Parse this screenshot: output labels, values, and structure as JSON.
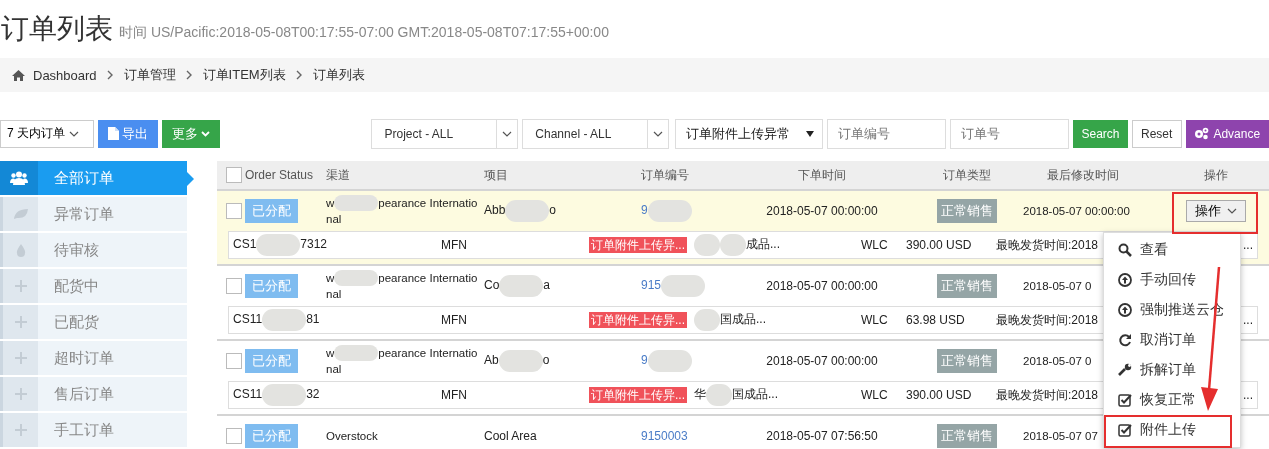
{
  "page": {
    "title": "订单列表",
    "subtitle": "时间 US/Pacific:2018-05-08T00:17:55-07:00 GMT:2018-05-08T07:17:55+00:00"
  },
  "breadcrumb": [
    {
      "label": "Dashboard",
      "kind": "home"
    },
    {
      "label": "订单管理",
      "kind": "link"
    },
    {
      "label": "订单ITEM列表",
      "kind": "link"
    },
    {
      "label": "订单列表",
      "kind": "current"
    }
  ],
  "toolbar": {
    "range": "7 天内订单",
    "export": "导出",
    "more": "更多"
  },
  "filters": {
    "project": "Project - ALL",
    "channel": "Channel - ALL",
    "status": "订单附件上传异常",
    "order_no_placeholder": "订单编号",
    "order_id_placeholder": "订单号",
    "search": "Search",
    "reset": "Reset",
    "advance": "Advance"
  },
  "sidebar": {
    "items": [
      {
        "label": "全部订单",
        "kind": "group",
        "selected": true
      },
      {
        "label": "异常订单",
        "kind": "leaf",
        "selected": false
      },
      {
        "label": "待审核",
        "kind": "drop",
        "selected": false
      },
      {
        "label": "配货中",
        "kind": "plus",
        "selected": false
      },
      {
        "label": "已配货",
        "kind": "plus",
        "selected": false
      },
      {
        "label": "超时订单",
        "kind": "plus",
        "selected": false
      },
      {
        "label": "售后订单",
        "kind": "plus",
        "selected": false
      },
      {
        "label": "手工订单",
        "kind": "plus",
        "selected": false
      }
    ]
  },
  "table": {
    "columns": [
      "Order Status",
      "渠道",
      "项目",
      "订单编号",
      "下单时间",
      "订单类型",
      "最后修改时间",
      "操作"
    ],
    "header_checked": false,
    "rows": [
      {
        "checked": false,
        "highlighted": true,
        "status": "已分配",
        "channel": [
          {
            "kind": "text",
            "text": "w"
          },
          {
            "kind": "blur"
          },
          {
            "kind": "text",
            "text": "pearance Internatio"
          },
          {
            "kind": "break"
          },
          {
            "kind": "text",
            "text": "nal"
          }
        ],
        "project": [
          {
            "kind": "text",
            "text": "Abb"
          },
          {
            "kind": "blur"
          },
          {
            "kind": "text",
            "text": "o"
          }
        ],
        "order_no": [
          {
            "kind": "text",
            "text": "9"
          },
          {
            "kind": "blur"
          }
        ],
        "order_time": "2018-05-07 00:00:00",
        "type": "正常销售",
        "modified": "2018-05-07 00:00:00",
        "action": "操作",
        "detail": {
          "code": [
            {
              "kind": "text",
              "text": "CS1"
            },
            {
              "kind": "blur"
            },
            {
              "kind": "text",
              "text": "7312"
            }
          ],
          "fulfil": "MFN",
          "tag": "订单附件上传异...",
          "product": [
            {
              "kind": "blur"
            },
            {
              "kind": "blur"
            },
            {
              "kind": "text",
              "text": "成品..."
            }
          ],
          "warehouse": "WLC",
          "amount": "390.00 USD",
          "deadline": "最晚发货时间:2018",
          "tail": "..."
        }
      },
      {
        "checked": false,
        "highlighted": false,
        "status": "已分配",
        "channel": [
          {
            "kind": "text",
            "text": "w"
          },
          {
            "kind": "blur"
          },
          {
            "kind": "text",
            "text": "pearance Internatio"
          },
          {
            "kind": "break"
          },
          {
            "kind": "text",
            "text": "nal"
          }
        ],
        "project": [
          {
            "kind": "text",
            "text": "Co"
          },
          {
            "kind": "blur"
          },
          {
            "kind": "text",
            "text": "a"
          }
        ],
        "order_no": [
          {
            "kind": "text",
            "text": "915"
          },
          {
            "kind": "blur"
          }
        ],
        "order_time": "2018-05-07 00:00:00",
        "type": "正常销售",
        "modified": "2018-05-07 0",
        "detail": {
          "code": [
            {
              "kind": "text",
              "text": "CS11"
            },
            {
              "kind": "blur"
            },
            {
              "kind": "text",
              "text": "81"
            }
          ],
          "fulfil": "MFN",
          "tag": "订单附件上传异...",
          "product": [
            {
              "kind": "blur"
            },
            {
              "kind": "text",
              "text": "国成品..."
            }
          ],
          "warehouse": "WLC",
          "amount": "63.98 USD",
          "deadline": "最晚发货时间:2018",
          "tail": "..."
        }
      },
      {
        "checked": false,
        "highlighted": false,
        "status": "已分配",
        "channel": [
          {
            "kind": "text",
            "text": "w"
          },
          {
            "kind": "blur"
          },
          {
            "kind": "text",
            "text": "pearance Internatio"
          },
          {
            "kind": "break"
          },
          {
            "kind": "text",
            "text": "nal"
          }
        ],
        "project": [
          {
            "kind": "text",
            "text": "Ab"
          },
          {
            "kind": "blur"
          },
          {
            "kind": "text",
            "text": "o"
          }
        ],
        "order_no": [
          {
            "kind": "text",
            "text": "9"
          },
          {
            "kind": "blur"
          }
        ],
        "order_time": "2018-05-07 00:00:00",
        "type": "正常销售",
        "modified": "2018-05-07 0",
        "detail": {
          "code": [
            {
              "kind": "text",
              "text": "CS11"
            },
            {
              "kind": "blur"
            },
            {
              "kind": "text",
              "text": "32"
            }
          ],
          "fulfil": "MFN",
          "tag": "订单附件上传异...",
          "product": [
            {
              "kind": "text",
              "text": "华"
            },
            {
              "kind": "blur"
            },
            {
              "kind": "text",
              "text": "国成品..."
            }
          ],
          "warehouse": "WLC",
          "amount": "390.00 USD",
          "deadline": "最晚发货时间:2018",
          "tail": "..."
        }
      },
      {
        "checked": false,
        "highlighted": false,
        "status": "已分配",
        "channel": [
          {
            "kind": "text",
            "text": "Overstock"
          }
        ],
        "project": [
          {
            "kind": "text",
            "text": "Cool Area"
          }
        ],
        "order_no": [
          {
            "kind": "text",
            "text": "9150003"
          }
        ],
        "order_time": "2018-05-07 07:56:50",
        "type": "正常销售",
        "modified": "2018-05-07 07"
      }
    ]
  },
  "menu": {
    "items": [
      {
        "kind": "search",
        "label": "查看"
      },
      {
        "kind": "upload",
        "label": "手动回传"
      },
      {
        "kind": "upload",
        "label": "强制推送云仓"
      },
      {
        "kind": "redo",
        "label": "取消订单"
      },
      {
        "kind": "wrench",
        "label": "拆解订单"
      },
      {
        "kind": "check",
        "label": "恢复正常"
      },
      {
        "kind": "check",
        "label": "附件上传"
      }
    ]
  }
}
